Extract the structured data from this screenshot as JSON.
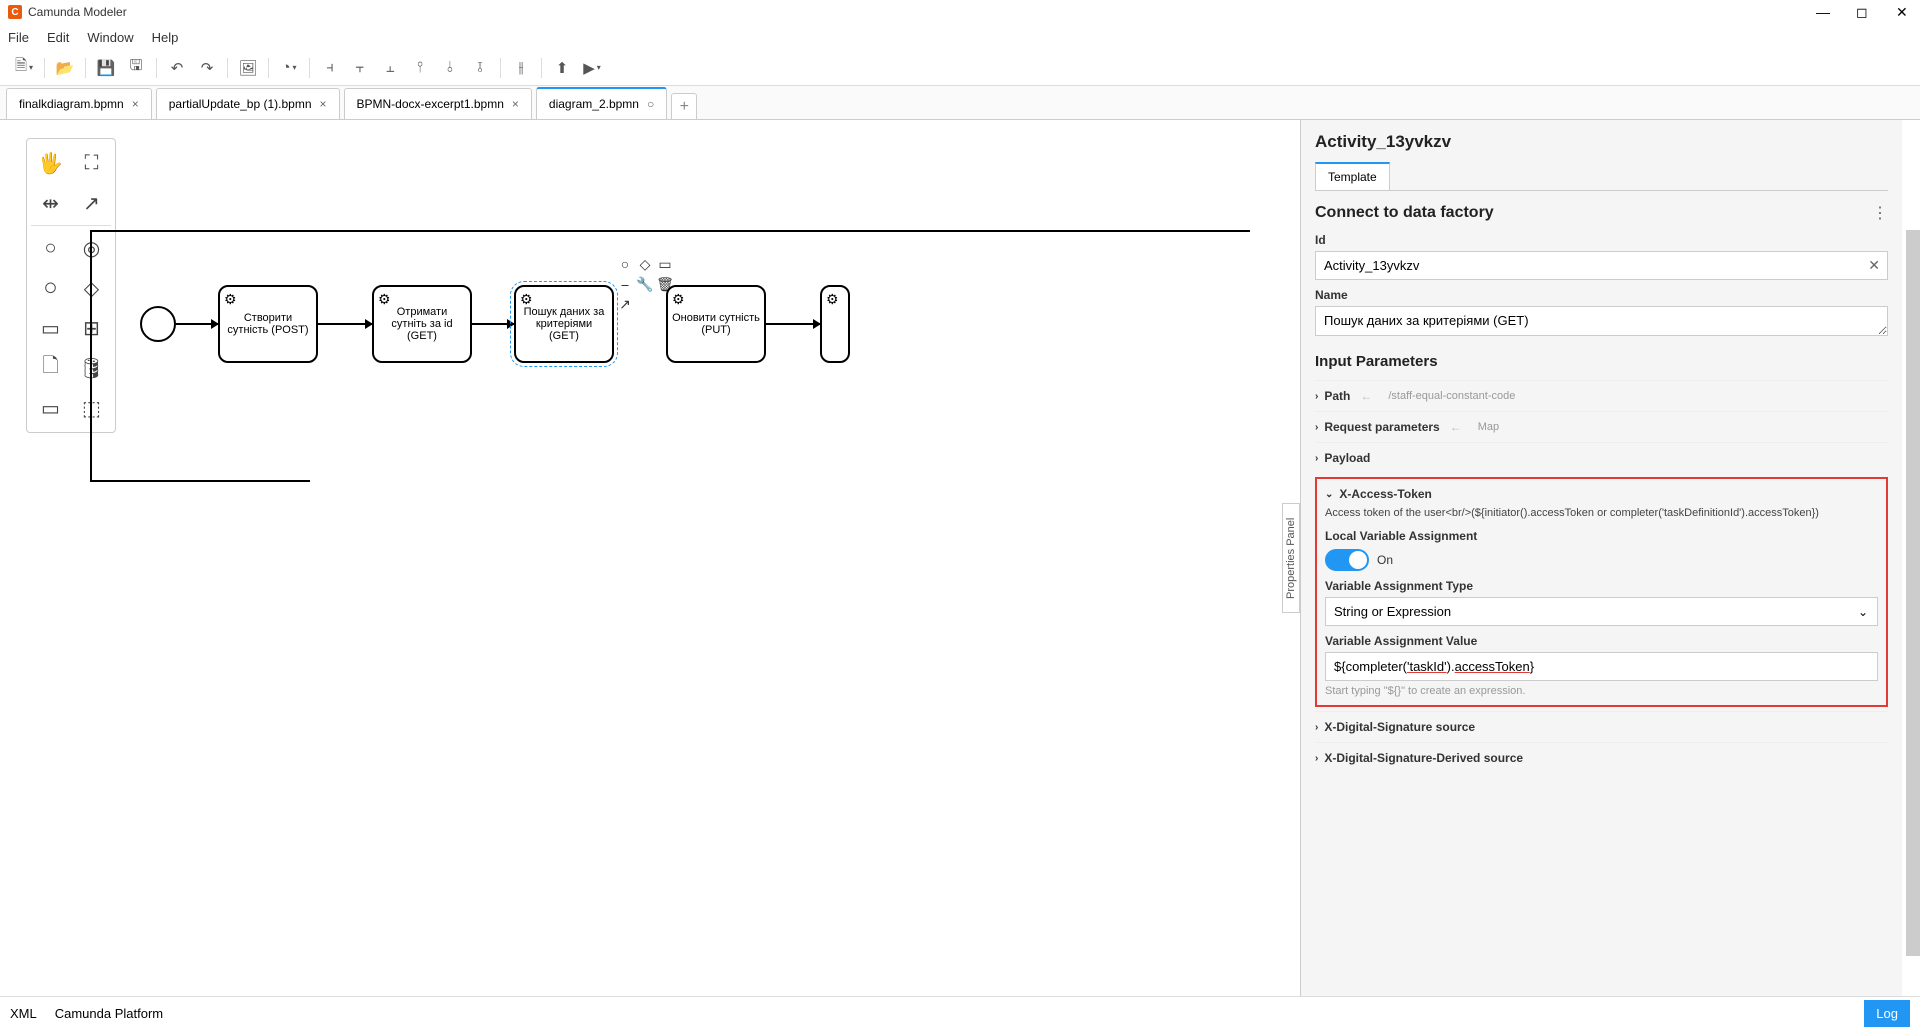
{
  "app": {
    "title": "Camunda Modeler"
  },
  "menubar": [
    "File",
    "Edit",
    "Window",
    "Help"
  ],
  "tabs": [
    {
      "label": "finalkdiagram.bpmn",
      "dirty": false
    },
    {
      "label": "partialUpdate_bp (1).bpmn",
      "dirty": false
    },
    {
      "label": "BPMN-docx-excerpt1.bpmn",
      "dirty": false
    },
    {
      "label": "diagram_2.bpmn",
      "dirty": true,
      "active": true
    }
  ],
  "diagram": {
    "task1": "Створити сутність (POST)",
    "task2": "Отримати сутніть за id (GET)",
    "task3": "Пошук даних за критеріями (GET)",
    "task4": "Оновити сутність (PUT)"
  },
  "prop_toggle": "Properties Panel",
  "properties": {
    "element_name": "Activity_13yvkzv",
    "tab": "Template",
    "section": "Connect to data factory",
    "id_label": "Id",
    "id_value": "Activity_13yvkzv",
    "name_label": "Name",
    "name_value": "Пошук даних за критеріями (GET)",
    "inputs_title": "Input Parameters",
    "path": {
      "label": "Path",
      "hint": "/staff-equal-constant-code"
    },
    "req_params": {
      "label": "Request parameters",
      "hint": "Map"
    },
    "payload": {
      "label": "Payload"
    },
    "xtoken": {
      "label": "X-Access-Token",
      "desc": "Access token of the user<br/>(${initiator().accessToken or completer('taskDefinitionId').accessToken})",
      "lva_label": "Local Variable Assignment",
      "lva_value": "On",
      "vat_label": "Variable Assignment Type",
      "vat_value": "String or Expression",
      "vav_label": "Variable Assignment Value",
      "vav_value_prefix": "${completer(",
      "vav_value_mid": "'taskId'",
      "vav_value_sep": ").",
      "vav_value_suffix": "accessToken",
      "vav_value_end": "}",
      "vav_hint": "Start typing \"${}\" to create an expression."
    },
    "xsig": {
      "label": "X-Digital-Signature source"
    },
    "xsigd": {
      "label": "X-Digital-Signature-Derived source"
    }
  },
  "statusbar": {
    "xml": "XML",
    "platform": "Camunda Platform",
    "log": "Log"
  }
}
